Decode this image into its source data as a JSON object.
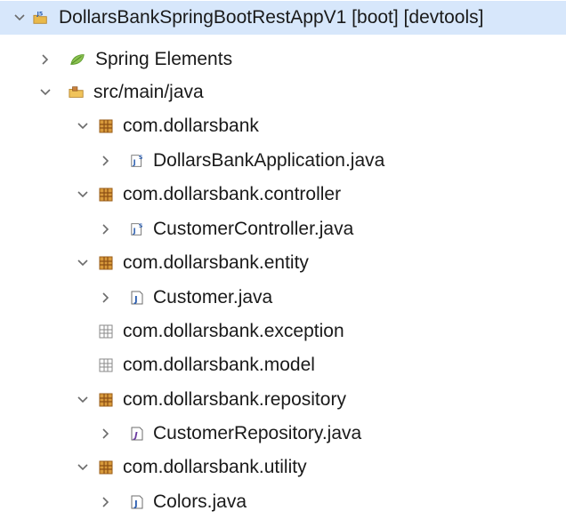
{
  "project_explorer": {
    "nodes": [
      {
        "label": "DollarsBankSpringBootRestAppV1 [boot] [devtools]",
        "icon": "spring-boot-project-icon",
        "expanded": true,
        "selected": true
      },
      {
        "label": "Spring Elements",
        "icon": "spring-leaf-icon",
        "expanded": false
      },
      {
        "label": "src/main/java",
        "icon": "source-folder-icon",
        "expanded": true
      },
      {
        "label": "com.dollarsbank",
        "icon": "package-icon",
        "expanded": true
      },
      {
        "label": "DollarsBankApplication.java",
        "icon": "spring-java-file-icon",
        "expanded": false
      },
      {
        "label": "com.dollarsbank.controller",
        "icon": "package-icon",
        "expanded": true
      },
      {
        "label": "CustomerController.java",
        "icon": "spring-java-file-icon",
        "expanded": false
      },
      {
        "label": "com.dollarsbank.entity",
        "icon": "package-icon",
        "expanded": true
      },
      {
        "label": "Customer.java",
        "icon": "java-file-icon",
        "expanded": false
      },
      {
        "label": "com.dollarsbank.exception",
        "icon": "empty-package-icon"
      },
      {
        "label": "com.dollarsbank.model",
        "icon": "empty-package-icon"
      },
      {
        "label": "com.dollarsbank.repository",
        "icon": "package-icon",
        "expanded": true
      },
      {
        "label": "CustomerRepository.java",
        "icon": "java-interface-file-icon",
        "expanded": false
      },
      {
        "label": "com.dollarsbank.utility",
        "icon": "package-icon",
        "expanded": true
      },
      {
        "label": "Colors.java",
        "icon": "java-file-icon",
        "expanded": false
      }
    ]
  },
  "colors": {
    "selection_background": "#d7e7fb",
    "package_icon": "#b9792a",
    "spring_leaf": "#6db33f",
    "folder": "#e9b94a",
    "arrow": "#6b6b6b"
  }
}
